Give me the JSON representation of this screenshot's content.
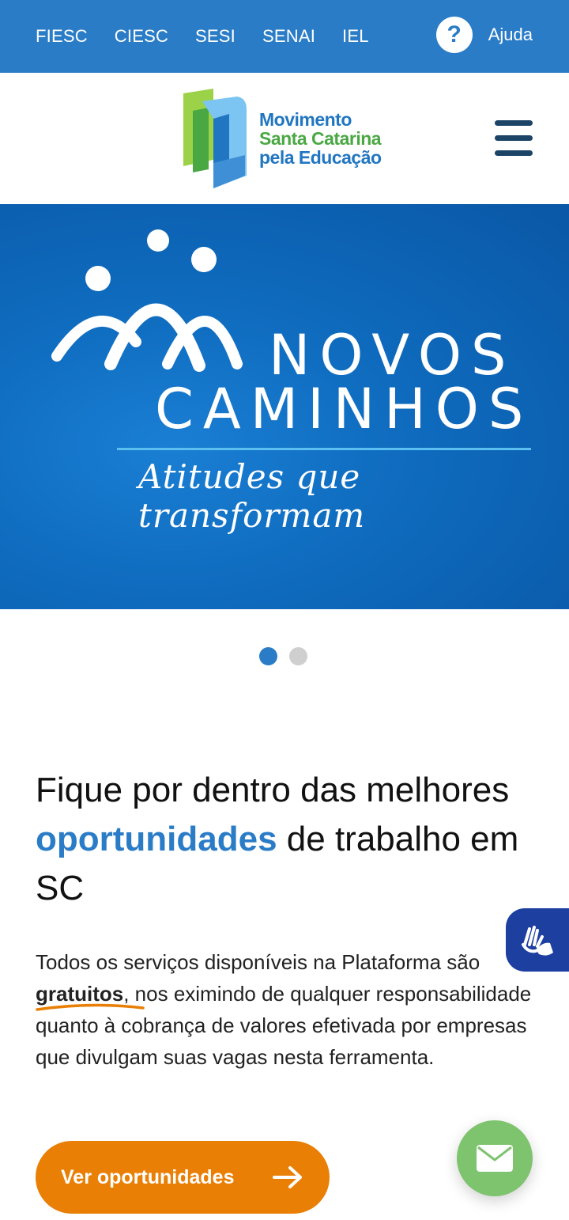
{
  "topbar": {
    "links": [
      "FIESC",
      "CIESC",
      "SESI",
      "SENAI",
      "IEL"
    ],
    "help_label": "Ajuda",
    "help_icon": "?"
  },
  "logo": {
    "line1": "Movimento",
    "line2": "Santa Catarina",
    "line3": "pela Educação"
  },
  "banner": {
    "title_line1": "NOVOS",
    "title_line2": "CAMINHOS",
    "tagline": "Atitudes que transformam"
  },
  "carousel": {
    "total": 2,
    "active": 1
  },
  "headline": {
    "part1": "Fique por dentro das melhores ",
    "highlight": "oportunidades",
    "part2": " de trabalho em SC"
  },
  "paragraph": {
    "part1": "Todos os serviços disponíveis na Plataforma são ",
    "bold": "gratuitos",
    "part2": ", nos eximindo de qualquer responsabilidade quanto à cobrança de valores efetivada por empresas que divulgam suas vagas nesta ferramenta."
  },
  "cta": {
    "label": "Ver oportunidades"
  },
  "colors": {
    "primary": "#2a7cc7",
    "cta": "#e97f05",
    "mail": "#7ec36e",
    "libras": "#1d3fa0"
  }
}
